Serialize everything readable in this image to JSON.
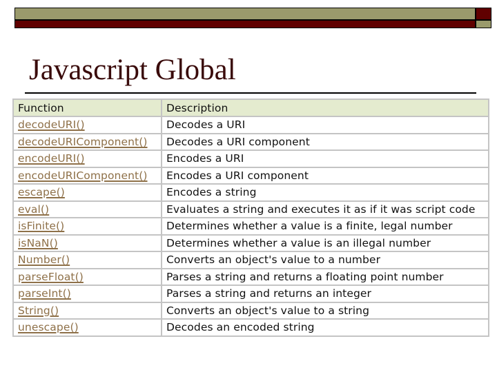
{
  "slide": {
    "title": "Javascript Global",
    "colors": {
      "bar_olive": "#9a9a6c",
      "bar_dark_red": "#600000",
      "title_color": "#3a0b0b",
      "header_bg": "#e4ebcf",
      "link_color": "#8e7048",
      "grid_color": "#c4c4c4"
    }
  },
  "table": {
    "headers": {
      "function": "Function",
      "description": "Description"
    },
    "rows": [
      {
        "function": "decodeURI()",
        "description": "Decodes a URI"
      },
      {
        "function": "decodeURIComponent()",
        "description": "Decodes a URI component"
      },
      {
        "function": "encodeURI()",
        "description": "Encodes a URI"
      },
      {
        "function": "encodeURIComponent()",
        "description": "Encodes a URI component"
      },
      {
        "function": "escape()",
        "description": "Encodes a string"
      },
      {
        "function": "eval()",
        "description": "Evaluates a string and executes it as if it was script code"
      },
      {
        "function": "isFinite()",
        "description": "Determines whether a value is a finite, legal number"
      },
      {
        "function": "isNaN()",
        "description": "Determines whether a value is an illegal number"
      },
      {
        "function": "Number()",
        "description": "Converts an object's value to a number"
      },
      {
        "function": "parseFloat()",
        "description": "Parses a string and returns a floating point number"
      },
      {
        "function": "parseInt()",
        "description": "Parses a string and returns an integer"
      },
      {
        "function": "String()",
        "description": "Converts an object's value to a string"
      },
      {
        "function": "unescape()",
        "description": "Decodes an encoded string"
      }
    ]
  }
}
